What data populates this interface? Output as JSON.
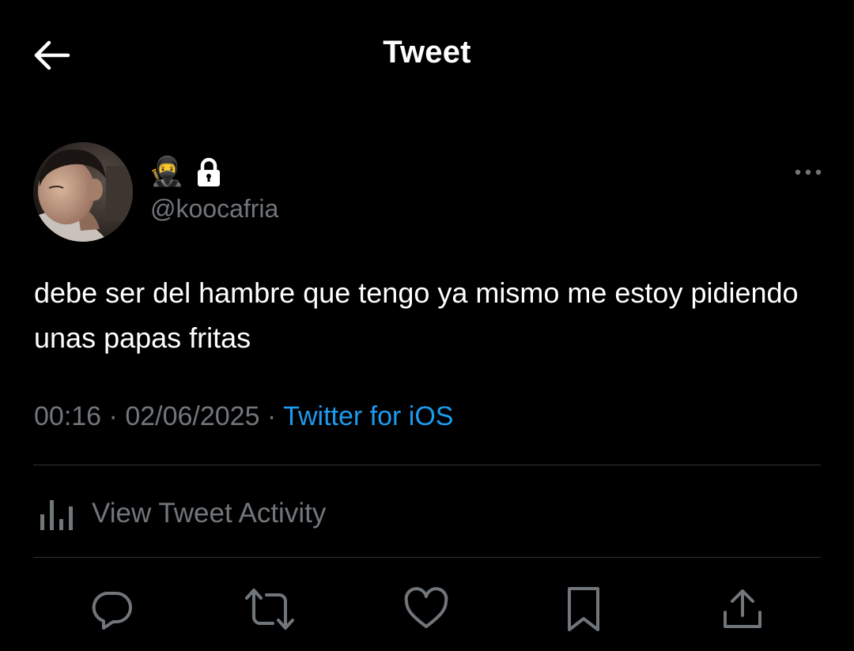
{
  "header": {
    "title": "Tweet",
    "back_icon": "arrow-left-icon"
  },
  "author": {
    "display_name_emoji": "🥷",
    "protected_icon": "lock-icon",
    "handle": "@koocafria",
    "avatar_icon": "avatar-photo",
    "more_icon": "more-horizontal-icon"
  },
  "tweet": {
    "text": "debe ser del hambre que tengo ya mismo me estoy pidiendo unas papas fritas",
    "time": "00:16",
    "separator": " · ",
    "date": "02/06/2025",
    "source": "Twitter for iOS"
  },
  "activity": {
    "label": "View Tweet Activity",
    "icon": "bar-chart-icon"
  },
  "actions": [
    {
      "name": "reply",
      "icon": "reply-icon"
    },
    {
      "name": "retweet",
      "icon": "retweet-icon"
    },
    {
      "name": "like",
      "icon": "heart-icon"
    },
    {
      "name": "bookmark",
      "icon": "bookmark-icon"
    },
    {
      "name": "share",
      "icon": "share-icon"
    }
  ],
  "colors": {
    "background": "#000000",
    "text": "#ffffff",
    "secondary": "#71767b",
    "link": "#1d9bf0",
    "divider": "#2f3336"
  }
}
